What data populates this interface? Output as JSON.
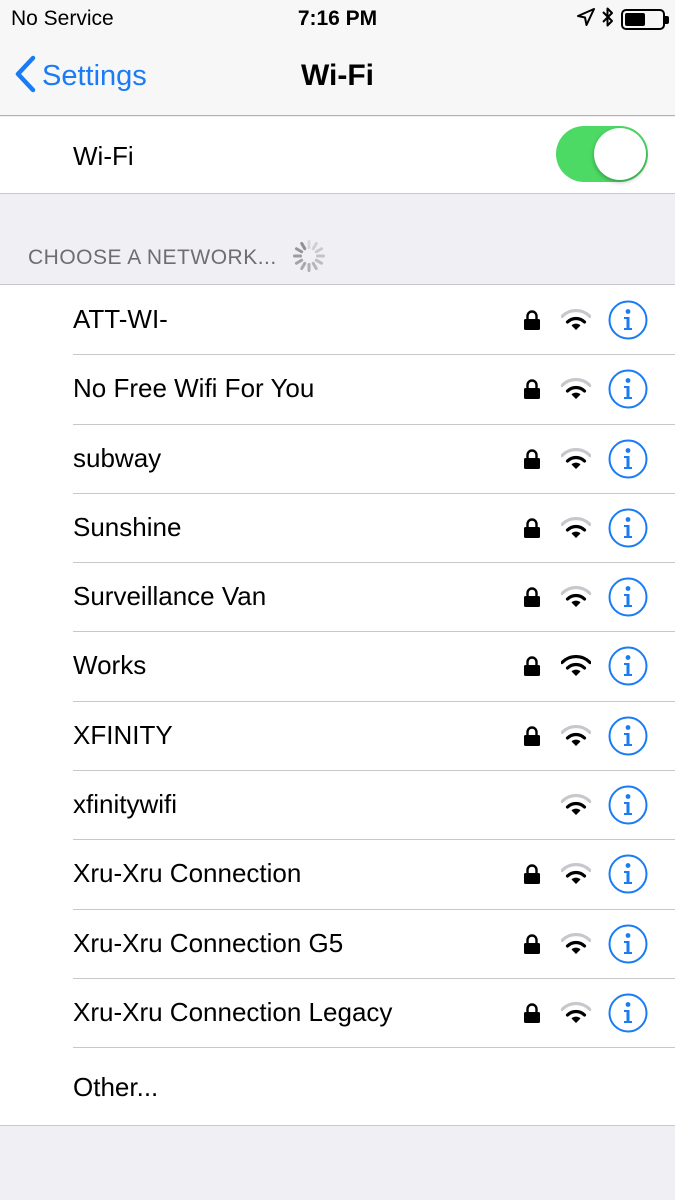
{
  "status_bar": {
    "carrier": "No Service",
    "time": "7:16 PM",
    "battery_level": 0.55
  },
  "nav": {
    "back_label": "Settings",
    "title": "Wi-Fi"
  },
  "wifi_toggle": {
    "label": "Wi-Fi",
    "on": true
  },
  "section": {
    "header": "CHOOSE A NETWORK..."
  },
  "networks": [
    {
      "name": "ATT-WI-",
      "locked": true,
      "signal_bars": 2
    },
    {
      "name": "No Free Wifi For You",
      "locked": true,
      "signal_bars": 2
    },
    {
      "name": "subway",
      "locked": true,
      "signal_bars": 2
    },
    {
      "name": "Sunshine",
      "locked": true,
      "signal_bars": 2
    },
    {
      "name": "Surveillance Van",
      "locked": true,
      "signal_bars": 2
    },
    {
      "name": "Works",
      "locked": true,
      "signal_bars": 3
    },
    {
      "name": "XFINITY",
      "locked": true,
      "signal_bars": 2
    },
    {
      "name": "xfinitywifi",
      "locked": false,
      "signal_bars": 2
    },
    {
      "name": "Xru-Xru Connection",
      "locked": true,
      "signal_bars": 2
    },
    {
      "name": "Xru-Xru Connection G5",
      "locked": true,
      "signal_bars": 2
    },
    {
      "name": "Xru-Xru Connection Legacy",
      "locked": true,
      "signal_bars": 2
    }
  ],
  "other": {
    "label": "Other..."
  },
  "colors": {
    "accent": "#1a7cf5",
    "switch_on": "#4cd964",
    "background": "#efeff4",
    "separator": "#c8c7cc",
    "section_text": "#6d6d72"
  },
  "icons": {
    "back": "chevron-left-icon",
    "location": "location-arrow-icon",
    "bluetooth": "bluetooth-icon",
    "battery": "battery-icon",
    "spinner": "activity-spinner-icon",
    "lock": "lock-icon",
    "wifi": "wifi-signal-icon",
    "info": "info-icon"
  }
}
